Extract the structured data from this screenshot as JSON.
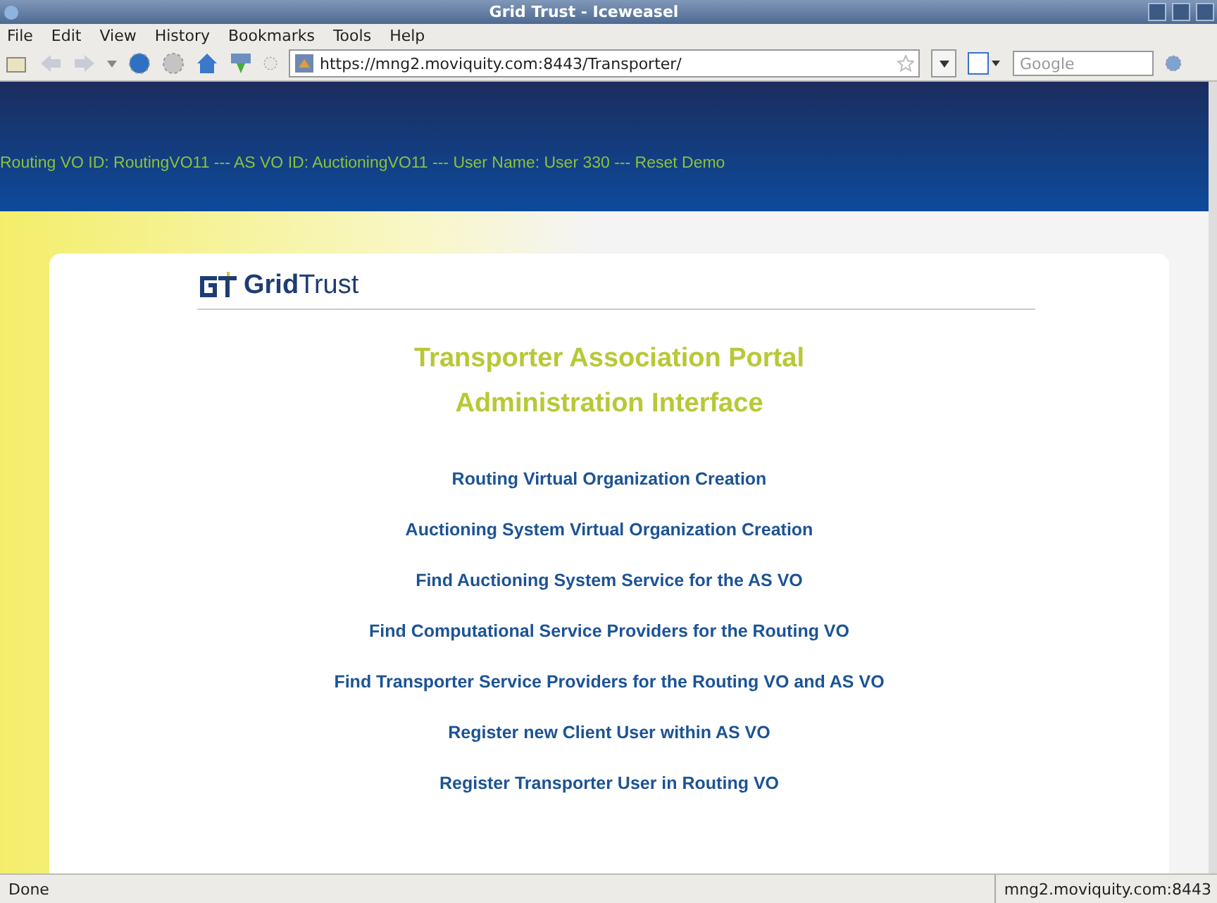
{
  "window": {
    "title": "Grid Trust - Iceweasel"
  },
  "menu": [
    "File",
    "Edit",
    "View",
    "History",
    "Bookmarks",
    "Tools",
    "Help"
  ],
  "address_bar": {
    "value": "https://mng2.moviquity.com:8443/Transporter/"
  },
  "search": {
    "placeholder": "Google"
  },
  "header": {
    "info": "Routing VO ID: RoutingVO11 --- AS VO ID: AuctioningVO11 --- User Name: User 330 --- Reset Demo"
  },
  "logo": "**Grid**Trust",
  "titles": [
    "Transporter Association Portal",
    "Administration Interface"
  ],
  "links": [
    "Routing Virtual Organization Creation",
    "Auctioning System Virtual Organization Creation",
    "Find Auctioning System Service for the AS VO",
    "Find Computational Service Providers for the Routing VO",
    "Find Transporter Service Providers for the Routing VO and AS VO",
    "Register new Client User within AS VO",
    "Register Transporter User in Routing VO"
  ],
  "status_bar": {
    "status": "Done",
    "host": "mng2.moviquity.com:8443"
  }
}
